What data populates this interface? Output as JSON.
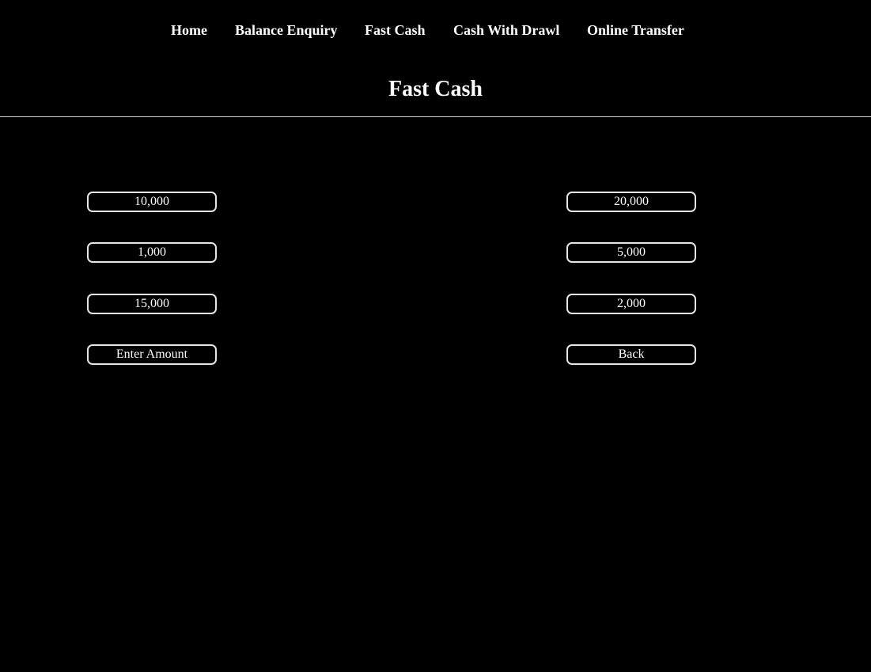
{
  "nav": {
    "items": [
      {
        "label": "Home"
      },
      {
        "label": "Balance Enquiry"
      },
      {
        "label": "Fast Cash"
      },
      {
        "label": "Cash With Drawl"
      },
      {
        "label": "Online Transfer"
      }
    ]
  },
  "page": {
    "title": "Fast Cash"
  },
  "amounts": {
    "left": [
      "10,000",
      "1,000",
      "15,000"
    ],
    "right": [
      "20,000",
      "5,000",
      "2,000"
    ]
  },
  "actions": {
    "enter_amount": "Enter Amount",
    "back": "Back"
  },
  "colors": {
    "background": "#000000",
    "text": "#ffffff",
    "button_border": "#e6e6e6"
  }
}
